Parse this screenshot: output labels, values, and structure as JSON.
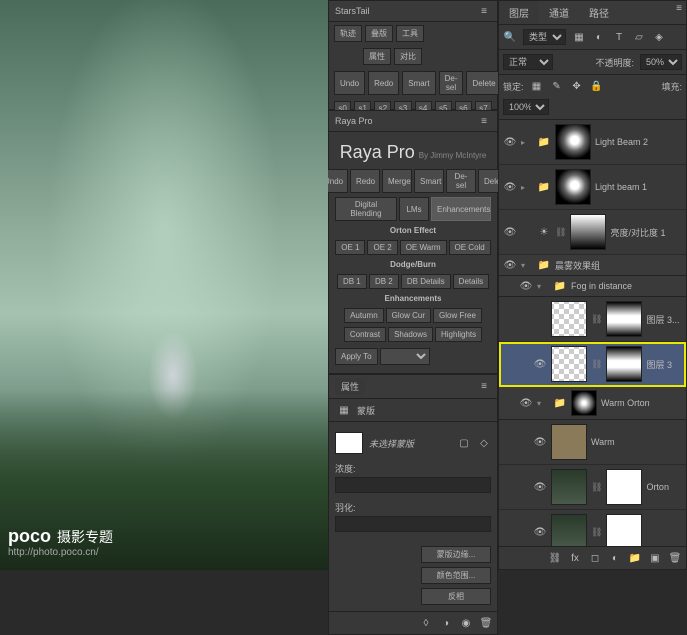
{
  "watermark": {
    "brand": "poco",
    "subtitle": "摄影专题",
    "url": "http://photo.poco.cn/"
  },
  "starstail": {
    "title": "StarsTail",
    "row1": [
      "轨迹",
      "叠版",
      "工具"
    ],
    "row2": [
      "属性",
      "对比"
    ],
    "actions": [
      "Undo",
      "Redo",
      "Smart",
      "De-sel",
      "Delete"
    ],
    "grid": [
      "s0",
      "s1",
      "s2",
      "s3",
      "s4",
      "s5",
      "s6",
      "s7"
    ]
  },
  "raya": {
    "title": "Raya Pro",
    "author": "By Jimmy McIntyre",
    "row_main": [
      "Undo",
      "Redo",
      "Merge",
      "Smart",
      "De-sel",
      "Delete"
    ],
    "row_mode": [
      "Digital Blending",
      "LMs",
      "Enhancements"
    ],
    "orton_label": "Orton Effect",
    "orton": [
      "OE 1",
      "OE 2",
      "OE Warm",
      "OE Cold"
    ],
    "dodge_label": "Dodge/Burn",
    "dodge": [
      "DB 1",
      "DB 2",
      "DB Details",
      "Details"
    ],
    "enh_label": "Enhancements",
    "enh1": [
      "Autumn",
      "Glow Cur",
      "Glow Free"
    ],
    "enh2": [
      "Contrast",
      "Shadows",
      "Highlights"
    ],
    "apply": "Apply To"
  },
  "properties": {
    "tab": "属性",
    "icon_label": "蒙版",
    "mask_label": "未选择蒙版",
    "density_label": "浓度:",
    "feather_label": "羽化:",
    "btn_refine": "蒙版边缘...",
    "btn_color": "颜色范围...",
    "btn_invert": "反相"
  },
  "layers": {
    "tabs": [
      "图层",
      "通道",
      "路径"
    ],
    "filter": "类型",
    "blend": "正常",
    "opacity_label": "不透明度:",
    "opacity": "50%",
    "lock_label": "锁定:",
    "fill_label": "填充:",
    "fill": "100%",
    "group_label": "晨雾效果组",
    "items": [
      {
        "name": "Light Beam 2",
        "expand": true
      },
      {
        "name": "Light beam 1",
        "expand": true
      },
      {
        "name": "亮度/对比度 1",
        "expand": false
      },
      {
        "name": "Fog in distance",
        "folder": true
      },
      {
        "name": "图层 3...",
        "sub": true
      },
      {
        "name": "图层 3",
        "selected": true,
        "sub": true
      },
      {
        "name": "Warm Orton",
        "folder": true
      },
      {
        "name": "Warm",
        "sub": true
      },
      {
        "name": "Orton",
        "sub": true
      }
    ]
  }
}
